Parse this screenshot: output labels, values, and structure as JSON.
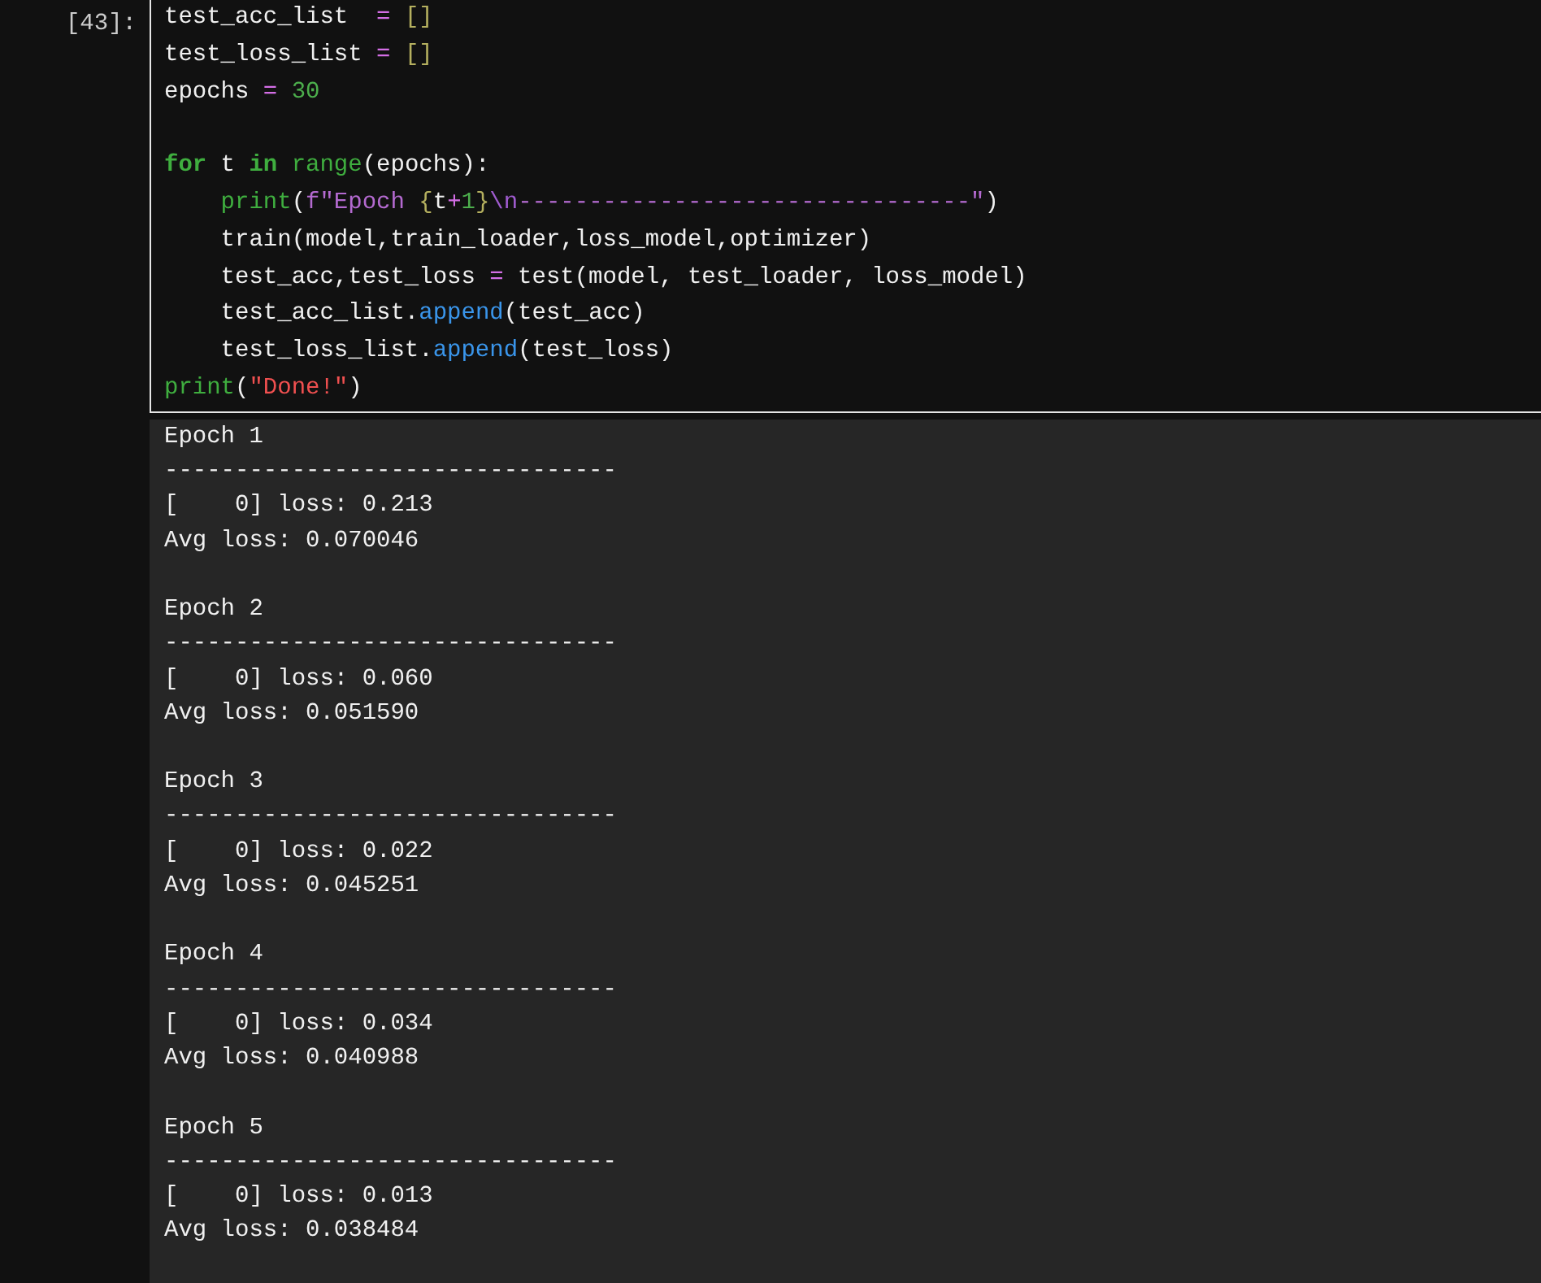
{
  "prompt": "[43]:",
  "code_lines": [
    {
      "kind": "code",
      "tokens": [
        {
          "text": "test_acc_list  ",
          "kind": "plain"
        },
        {
          "text": "= ",
          "kind": "op"
        },
        {
          "text": "[]",
          "kind": "bracket"
        }
      ]
    },
    {
      "kind": "code",
      "tokens": [
        {
          "text": "test_loss_list ",
          "kind": "plain"
        },
        {
          "text": "= ",
          "kind": "op"
        },
        {
          "text": "[]",
          "kind": "bracket"
        }
      ]
    },
    {
      "kind": "code",
      "tokens": [
        {
          "text": "epochs ",
          "kind": "plain"
        },
        {
          "text": "= ",
          "kind": "op"
        },
        {
          "text": "30",
          "kind": "number"
        }
      ]
    },
    {
      "kind": "blank"
    },
    {
      "kind": "code",
      "tokens": [
        {
          "text": "for",
          "kind": "keyword"
        },
        {
          "text": " t ",
          "kind": "plain"
        },
        {
          "text": "in",
          "kind": "keyword"
        },
        {
          "text": " range",
          "kind": "builtin"
        },
        {
          "text": "(epochs):",
          "kind": "plain"
        }
      ]
    },
    {
      "kind": "code",
      "tokens": [
        {
          "text": "    print",
          "kind": "builtin"
        },
        {
          "text": "(",
          "kind": "plain"
        },
        {
          "text": "f\"Epoch ",
          "kind": "string"
        },
        {
          "text": "{",
          "kind": "bracket"
        },
        {
          "text": "t",
          "kind": "plain"
        },
        {
          "text": "+",
          "kind": "op"
        },
        {
          "text": "1",
          "kind": "number"
        },
        {
          "text": "}",
          "kind": "bracket"
        },
        {
          "text": "\\n",
          "kind": "escape"
        },
        {
          "text": "--------------------------------\"",
          "kind": "string"
        },
        {
          "text": ")",
          "kind": "plain"
        }
      ]
    },
    {
      "kind": "code",
      "tokens": [
        {
          "text": "    train(model,train_loader,loss_model,optimizer)",
          "kind": "plain"
        }
      ]
    },
    {
      "kind": "code",
      "tokens": [
        {
          "text": "    test_acc,test_loss ",
          "kind": "plain"
        },
        {
          "text": "=",
          "kind": "op"
        },
        {
          "text": " test(model, test_loader, loss_model)",
          "kind": "plain"
        }
      ]
    },
    {
      "kind": "code",
      "tokens": [
        {
          "text": "    test_acc_list.",
          "kind": "plain"
        },
        {
          "text": "append",
          "kind": "method"
        },
        {
          "text": "(test_acc)",
          "kind": "plain"
        }
      ]
    },
    {
      "kind": "code",
      "tokens": [
        {
          "text": "    test_loss_list.",
          "kind": "plain"
        },
        {
          "text": "append",
          "kind": "method"
        },
        {
          "text": "(test_loss)",
          "kind": "plain"
        }
      ]
    },
    {
      "kind": "code",
      "tokens": [
        {
          "text": "print",
          "kind": "builtin"
        },
        {
          "text": "(",
          "kind": "plain"
        },
        {
          "text": "\"Done!\"",
          "kind": "redstring"
        },
        {
          "text": ")",
          "kind": "plain"
        }
      ]
    }
  ],
  "output_blocks": [
    {
      "lines": [
        "Epoch 1",
        "--------------------------------",
        "[    0] loss: 0.213",
        "Avg loss: 0.070046"
      ]
    },
    {
      "lines": [
        "Epoch 2",
        "--------------------------------",
        "[    0] loss: 0.060",
        "Avg loss: 0.051590"
      ]
    },
    {
      "lines": [
        "Epoch 3",
        "--------------------------------",
        "[    0] loss: 0.022",
        "Avg loss: 0.045251"
      ]
    },
    {
      "lines": [
        "Epoch 4",
        "--------------------------------",
        "[    0] loss: 0.034",
        "Avg loss: 0.040988"
      ]
    },
    {
      "lines": [
        "Epoch 5",
        "--------------------------------",
        "[    0] loss: 0.013",
        "Avg loss: 0.038484"
      ]
    }
  ]
}
